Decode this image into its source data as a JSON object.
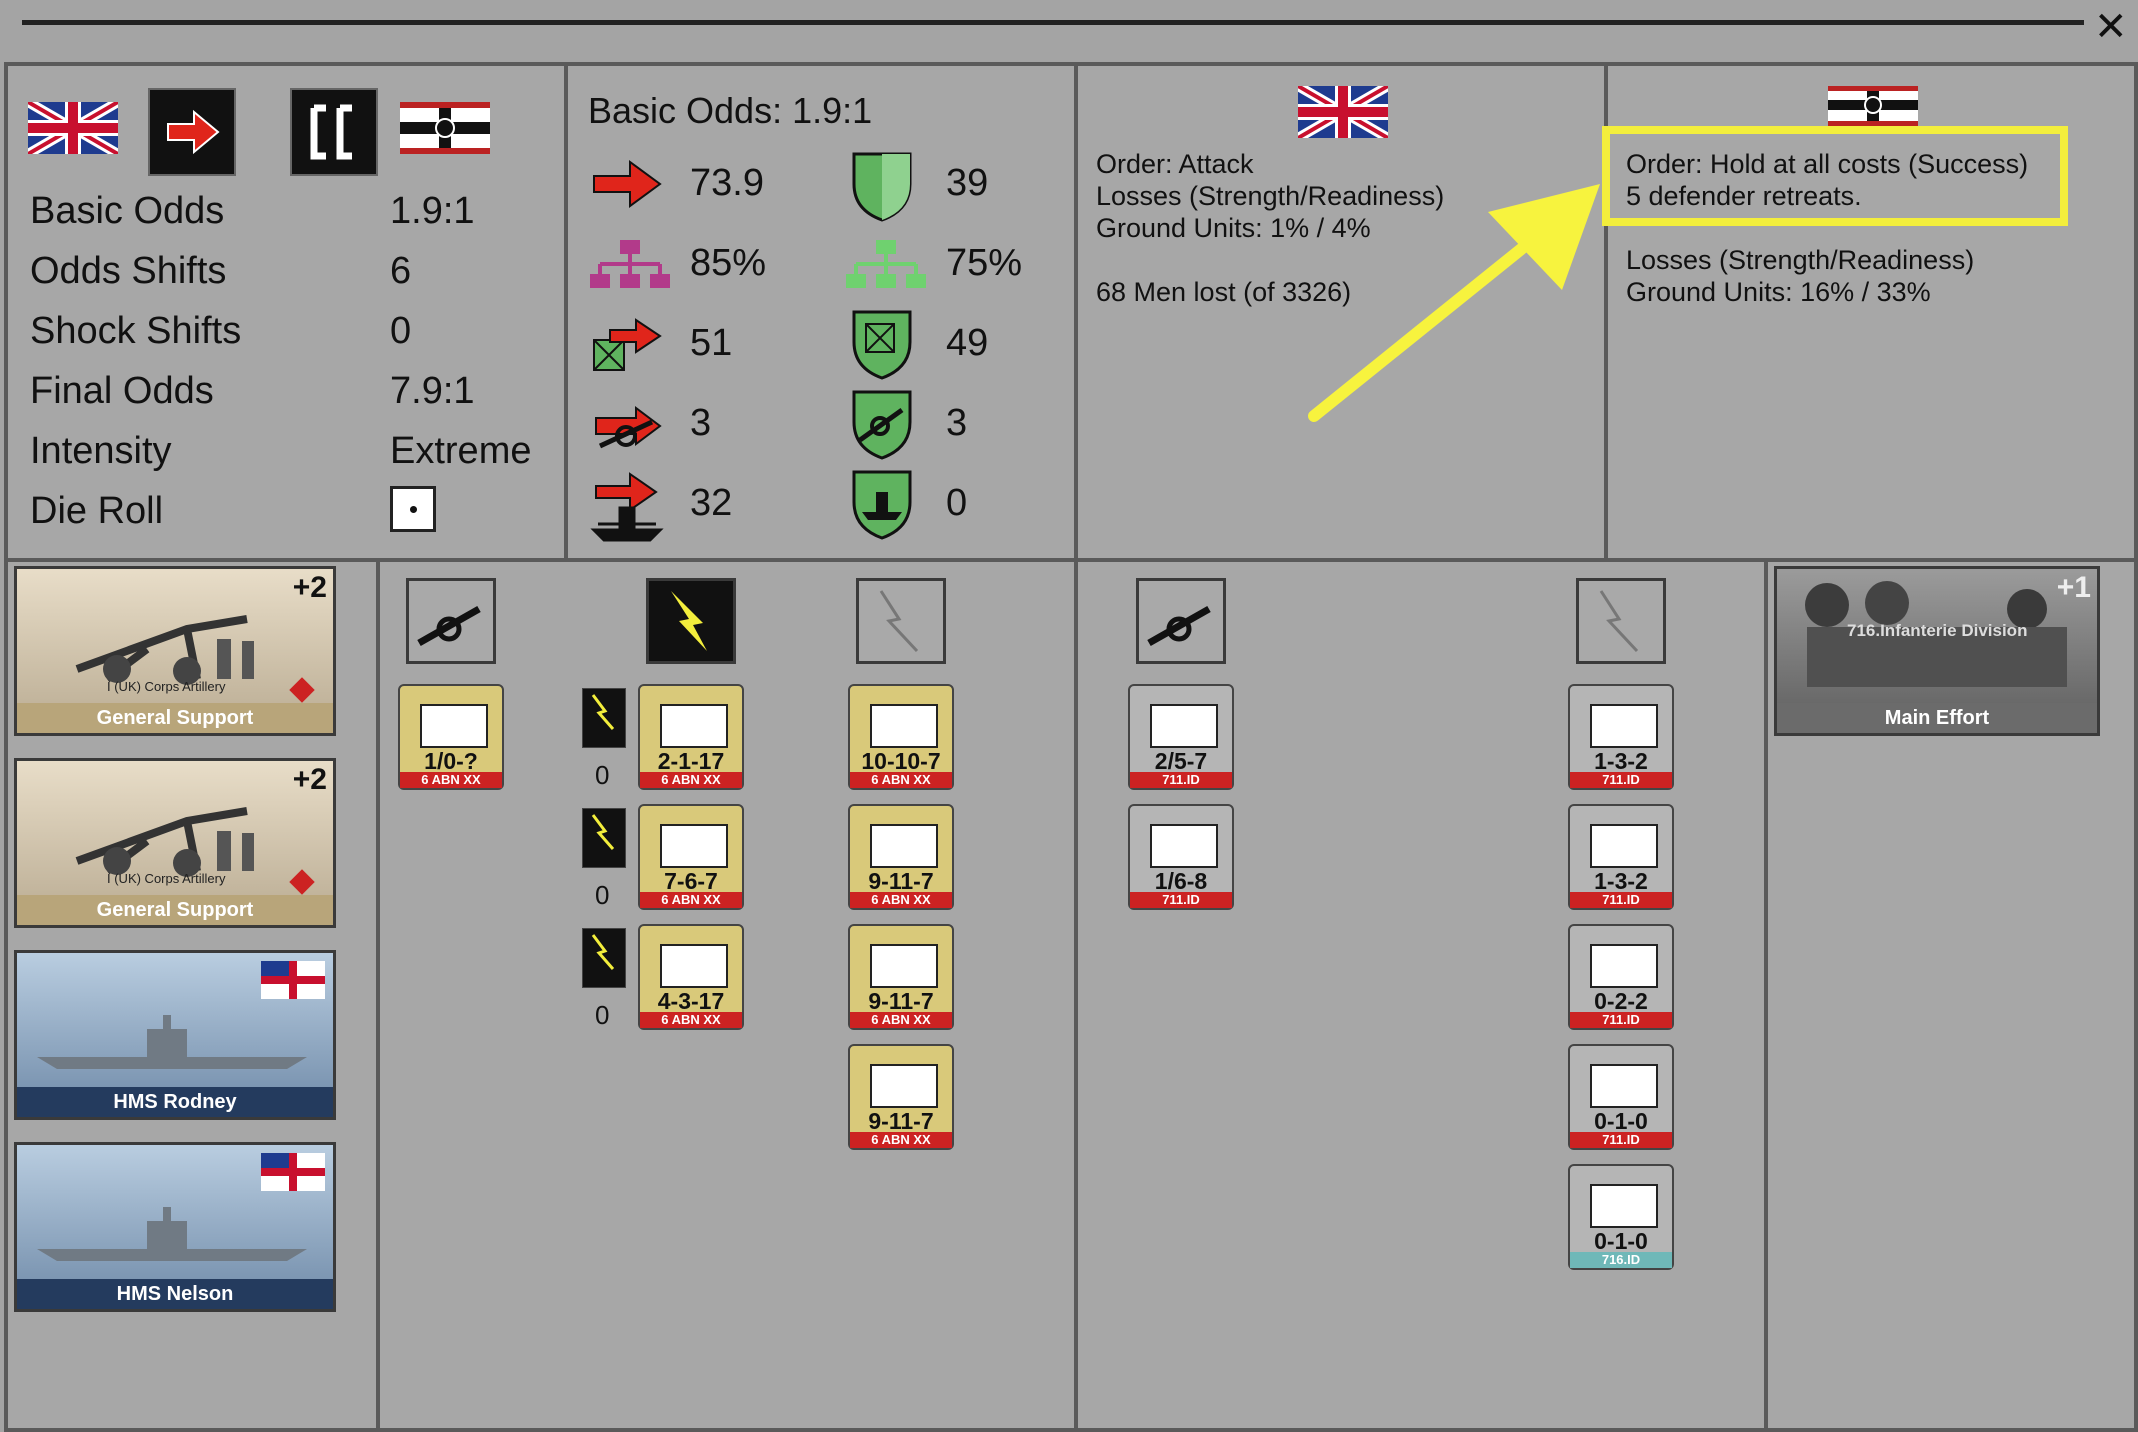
{
  "window": {
    "close_glyph": "✕"
  },
  "summary": {
    "rows": [
      {
        "label": "Basic Odds",
        "value": "1.9:1"
      },
      {
        "label": "Odds Shifts",
        "value": "6"
      },
      {
        "label": "Shock Shifts",
        "value": "0"
      },
      {
        "label": "Final Odds",
        "value": "7.9:1"
      },
      {
        "label": "Intensity",
        "value": "Extreme"
      },
      {
        "label": "Die Roll",
        "value": ""
      }
    ]
  },
  "odds_panel": {
    "title": "Basic Odds: 1.9:1",
    "attacker": [
      "73.9",
      "85%",
      "51",
      "3",
      "32"
    ],
    "defender": [
      "39",
      "75%",
      "49",
      "3",
      "0"
    ]
  },
  "allied_result": {
    "order": "Order: Attack",
    "losses_label": "Losses (Strength/Readiness)",
    "ground_units": "Ground Units: 1% / 4%",
    "men_lost": "68 Men lost (of 3326)"
  },
  "axis_result": {
    "order": "Order: Hold at all costs (Success)",
    "retreats": "5 defender retreats.",
    "losses_label": "Losses (Strength/Readiness)",
    "ground_units": "Ground Units: 16% / 33%"
  },
  "support_cards": [
    {
      "caption": "General Support",
      "subtitle": "I (UK) Corps Artillery",
      "bonus": "+2"
    },
    {
      "caption": "General Support",
      "subtitle": "I (UK) Corps Artillery",
      "bonus": "+2"
    },
    {
      "caption": "HMS Rodney",
      "type": "BB"
    },
    {
      "caption": "HMS Nelson",
      "type": "BB"
    }
  ],
  "allied_counters": {
    "artillery": [
      {
        "value": "1/0-?",
        "unit": "6 ABN XX"
      }
    ],
    "airborne_counts": [
      "0",
      "0",
      "0"
    ],
    "airborne": [
      {
        "value": "2-1-17",
        "unit": "6 ABN XX"
      },
      {
        "value": "7-6-7",
        "unit": "6 ABN XX"
      },
      {
        "value": "4-3-17",
        "unit": "6 ABN XX"
      }
    ],
    "infantry": [
      {
        "value": "10-10-7",
        "unit": "6 ABN XX"
      },
      {
        "value": "9-11-7",
        "unit": "6 ABN XX"
      },
      {
        "value": "9-11-7",
        "unit": "6 ABN XX"
      },
      {
        "value": "9-11-7",
        "unit": "6 ABN XX"
      }
    ]
  },
  "axis_counters": {
    "artillery": [
      {
        "value": "2/5-7",
        "unit": "711.ID"
      },
      {
        "value": "1/6-8",
        "unit": "711.ID"
      }
    ],
    "infantry": [
      {
        "value": "1-3-2",
        "unit": "711.ID"
      },
      {
        "value": "1-3-2",
        "unit": "711.ID"
      },
      {
        "value": "0-2-2",
        "unit": "711.ID"
      },
      {
        "value": "0-1-0",
        "unit": "711.ID"
      },
      {
        "value": "0-1-0",
        "unit": "716.ID"
      }
    ]
  },
  "axis_card": {
    "caption": "Main Effort",
    "title": "716.Infanterie Division",
    "bonus": "+1"
  },
  "colors": {
    "highlight": "#f3ee3c",
    "arrow": "#f7f33e",
    "attacker_red": "#e0251b",
    "defender_green": "#5fb35f",
    "org_purple": "#b23a8a"
  }
}
